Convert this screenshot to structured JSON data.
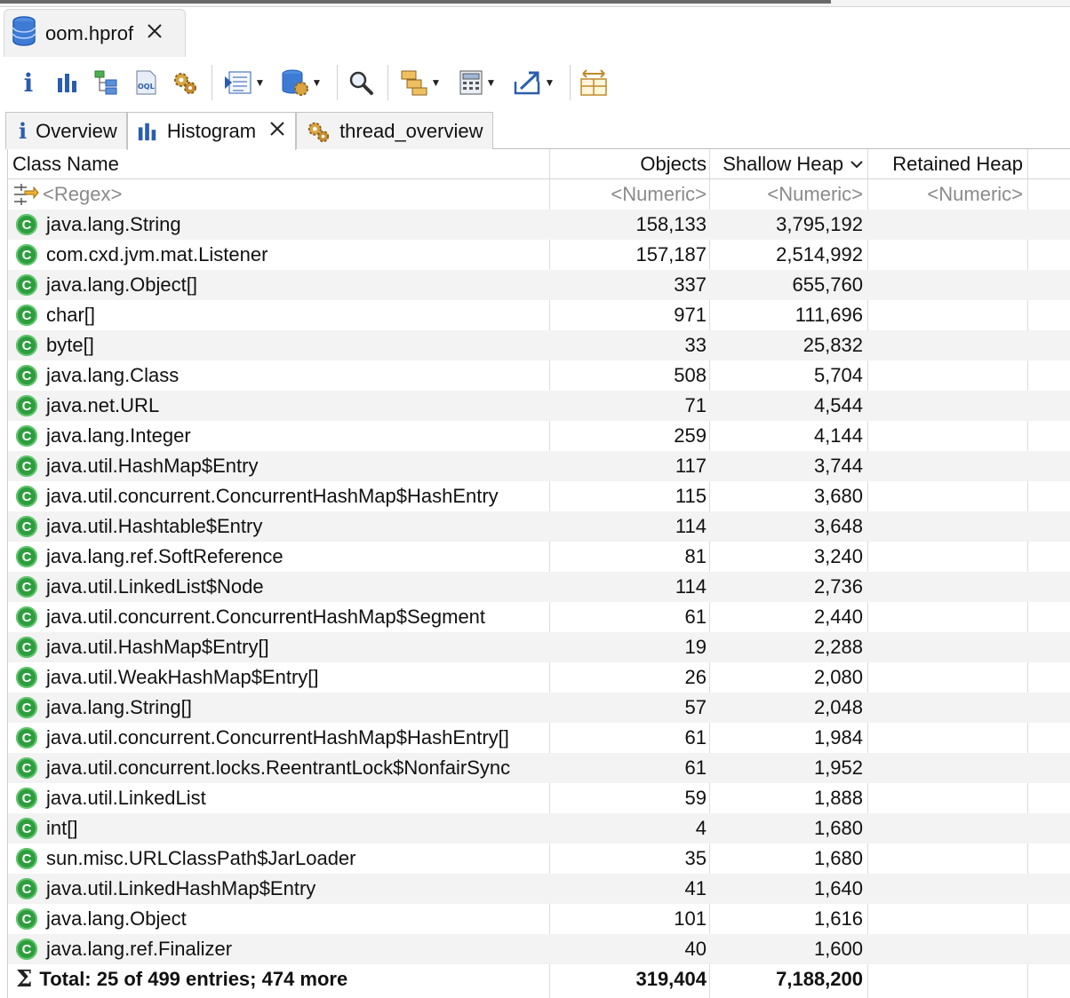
{
  "editor": {
    "tab_title": "oom.hprof"
  },
  "view_tabs": [
    {
      "label": "Overview"
    },
    {
      "label": "Histogram"
    },
    {
      "label": "thread_overview"
    }
  ],
  "table": {
    "headers": {
      "class_name": "Class Name",
      "objects": "Objects",
      "shallow_heap": "Shallow Heap",
      "retained_heap": "Retained Heap"
    },
    "filter": {
      "class_name": "<Regex>",
      "objects": "<Numeric>",
      "shallow_heap": "<Numeric>",
      "retained_heap": "<Numeric>"
    },
    "rows": [
      {
        "name": "java.lang.String",
        "objects": "158,133",
        "shallow": "3,795,192"
      },
      {
        "name": "com.cxd.jvm.mat.Listener",
        "objects": "157,187",
        "shallow": "2,514,992"
      },
      {
        "name": "java.lang.Object[]",
        "objects": "337",
        "shallow": "655,760"
      },
      {
        "name": "char[]",
        "objects": "971",
        "shallow": "111,696"
      },
      {
        "name": "byte[]",
        "objects": "33",
        "shallow": "25,832"
      },
      {
        "name": "java.lang.Class",
        "objects": "508",
        "shallow": "5,704"
      },
      {
        "name": "java.net.URL",
        "objects": "71",
        "shallow": "4,544"
      },
      {
        "name": "java.lang.Integer",
        "objects": "259",
        "shallow": "4,144"
      },
      {
        "name": "java.util.HashMap$Entry",
        "objects": "117",
        "shallow": "3,744"
      },
      {
        "name": "java.util.concurrent.ConcurrentHashMap$HashEntry",
        "objects": "115",
        "shallow": "3,680"
      },
      {
        "name": "java.util.Hashtable$Entry",
        "objects": "114",
        "shallow": "3,648"
      },
      {
        "name": "java.lang.ref.SoftReference",
        "objects": "81",
        "shallow": "3,240"
      },
      {
        "name": "java.util.LinkedList$Node",
        "objects": "114",
        "shallow": "2,736"
      },
      {
        "name": "java.util.concurrent.ConcurrentHashMap$Segment",
        "objects": "61",
        "shallow": "2,440"
      },
      {
        "name": "java.util.HashMap$Entry[]",
        "objects": "19",
        "shallow": "2,288"
      },
      {
        "name": "java.util.WeakHashMap$Entry[]",
        "objects": "26",
        "shallow": "2,080"
      },
      {
        "name": "java.lang.String[]",
        "objects": "57",
        "shallow": "2,048"
      },
      {
        "name": "java.util.concurrent.ConcurrentHashMap$HashEntry[]",
        "objects": "61",
        "shallow": "1,984"
      },
      {
        "name": "java.util.concurrent.locks.ReentrantLock$NonfairSync",
        "objects": "61",
        "shallow": "1,952"
      },
      {
        "name": "java.util.LinkedList",
        "objects": "59",
        "shallow": "1,888"
      },
      {
        "name": "int[]",
        "objects": "4",
        "shallow": "1,680"
      },
      {
        "name": "sun.misc.URLClassPath$JarLoader",
        "objects": "35",
        "shallow": "1,680"
      },
      {
        "name": "java.util.LinkedHashMap$Entry",
        "objects": "41",
        "shallow": "1,640"
      },
      {
        "name": "java.lang.Object",
        "objects": "101",
        "shallow": "1,616"
      },
      {
        "name": "java.lang.ref.Finalizer",
        "objects": "40",
        "shallow": "1,600"
      }
    ],
    "total": {
      "label": "Total: 25 of 499 entries; 474 more",
      "objects": "319,404",
      "shallow": "7,188,200"
    }
  },
  "icons": {
    "class_icon_letter": "C",
    "info_letter": "i"
  },
  "colors": {
    "class_icon": "#2e9d3e",
    "toolbar_blue": "#2a5db0",
    "row_stripe": "#f3f3f3"
  }
}
